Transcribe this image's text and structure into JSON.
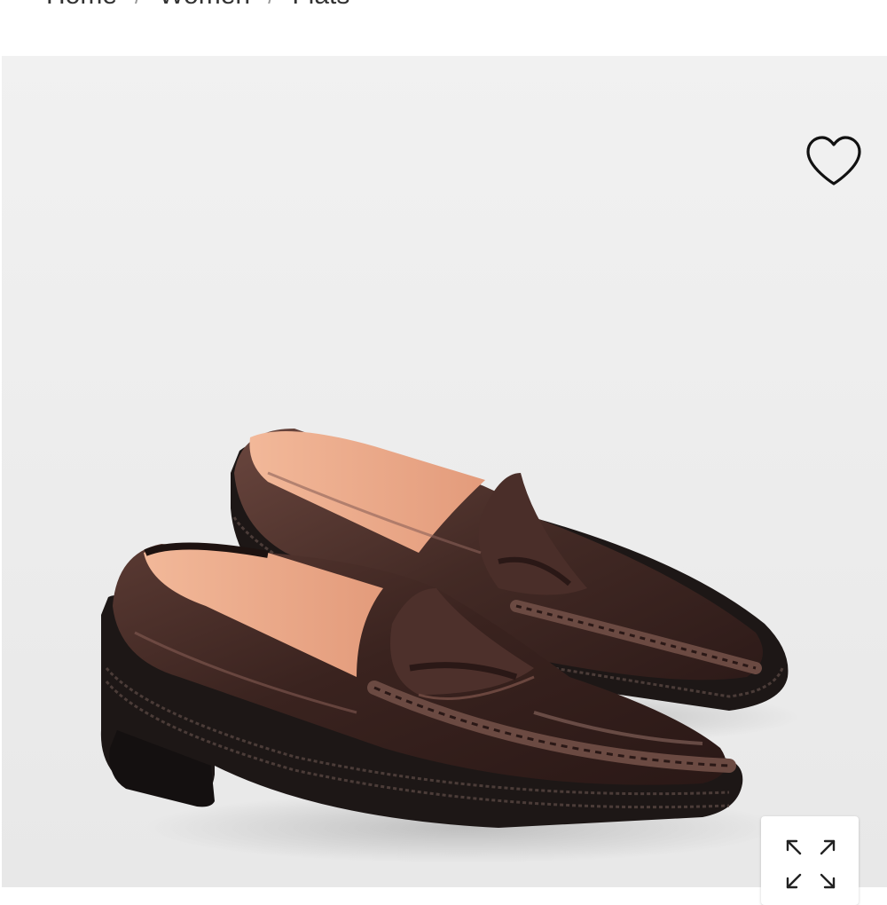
{
  "breadcrumb": {
    "items": [
      "Home",
      "Women",
      "Flats"
    ],
    "separator": "/"
  },
  "product": {
    "image_subject": "brown leather penny loafers",
    "colors": {
      "leather": "#3b2420",
      "lining": "#e9a98a",
      "sole": "#1d1716",
      "background": "#efefef"
    }
  },
  "icons": {
    "wishlist": "heart-outline-icon",
    "zoom": "expand-arrows-icon"
  }
}
